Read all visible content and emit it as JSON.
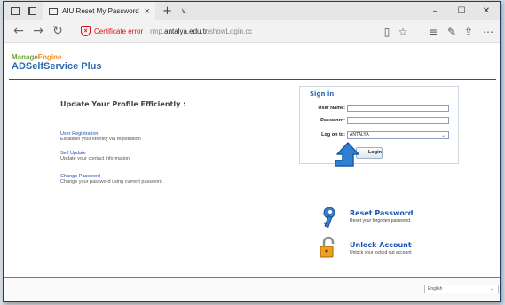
{
  "browser": {
    "tab_title": "AIU Reset My Password",
    "tab_close": "×",
    "new_tab": "+",
    "tab_list": "∨",
    "win_minimize": "–",
    "win_maximize": "☐",
    "win_close": "✕",
    "back": "←",
    "forward": "→",
    "refresh": "↻",
    "cert_error": "Certificate error",
    "url_prefix": "rmp.",
    "url_domain": "antalya.edu.tr",
    "url_path": "/showLogin.cc",
    "toolbar_icons": [
      "reading-view-icon",
      "favorite-star-icon",
      "hub-icon",
      "notes-icon",
      "share-icon",
      "more-icon"
    ]
  },
  "brand": {
    "line1_a": "Manage",
    "line1_b": "Engine",
    "line2": "ADSelfService Plus"
  },
  "left": {
    "heading": "Update Your Profile Efficiently :",
    "items": [
      {
        "link": "User Registration",
        "desc": "Establish your identity via registration"
      },
      {
        "link": "Self Update",
        "desc": "Update your contact information"
      },
      {
        "link": "Change Password",
        "desc": "Change your password using current password"
      }
    ]
  },
  "signin": {
    "title": "Sign in",
    "username_label": "User Name:",
    "username_value": "",
    "password_label": "Password:",
    "password_value": "",
    "logon_label": "Log on to:",
    "logon_value": "ANTALYA",
    "login_button": "Login"
  },
  "actions": [
    {
      "title": "Reset Password",
      "desc": "Reset your forgotten password",
      "icon": "key-icon"
    },
    {
      "title": "Unlock Account",
      "desc": "Unlock your locked out account",
      "icon": "padlock-icon"
    }
  ],
  "footer": {
    "language": "English"
  },
  "colors": {
    "link_blue": "#1b53b8",
    "brand_green": "#6aa136",
    "brand_orange": "#f08a1e",
    "cert_red": "#d11111",
    "annotation_arrow": "#2f7fd2"
  }
}
